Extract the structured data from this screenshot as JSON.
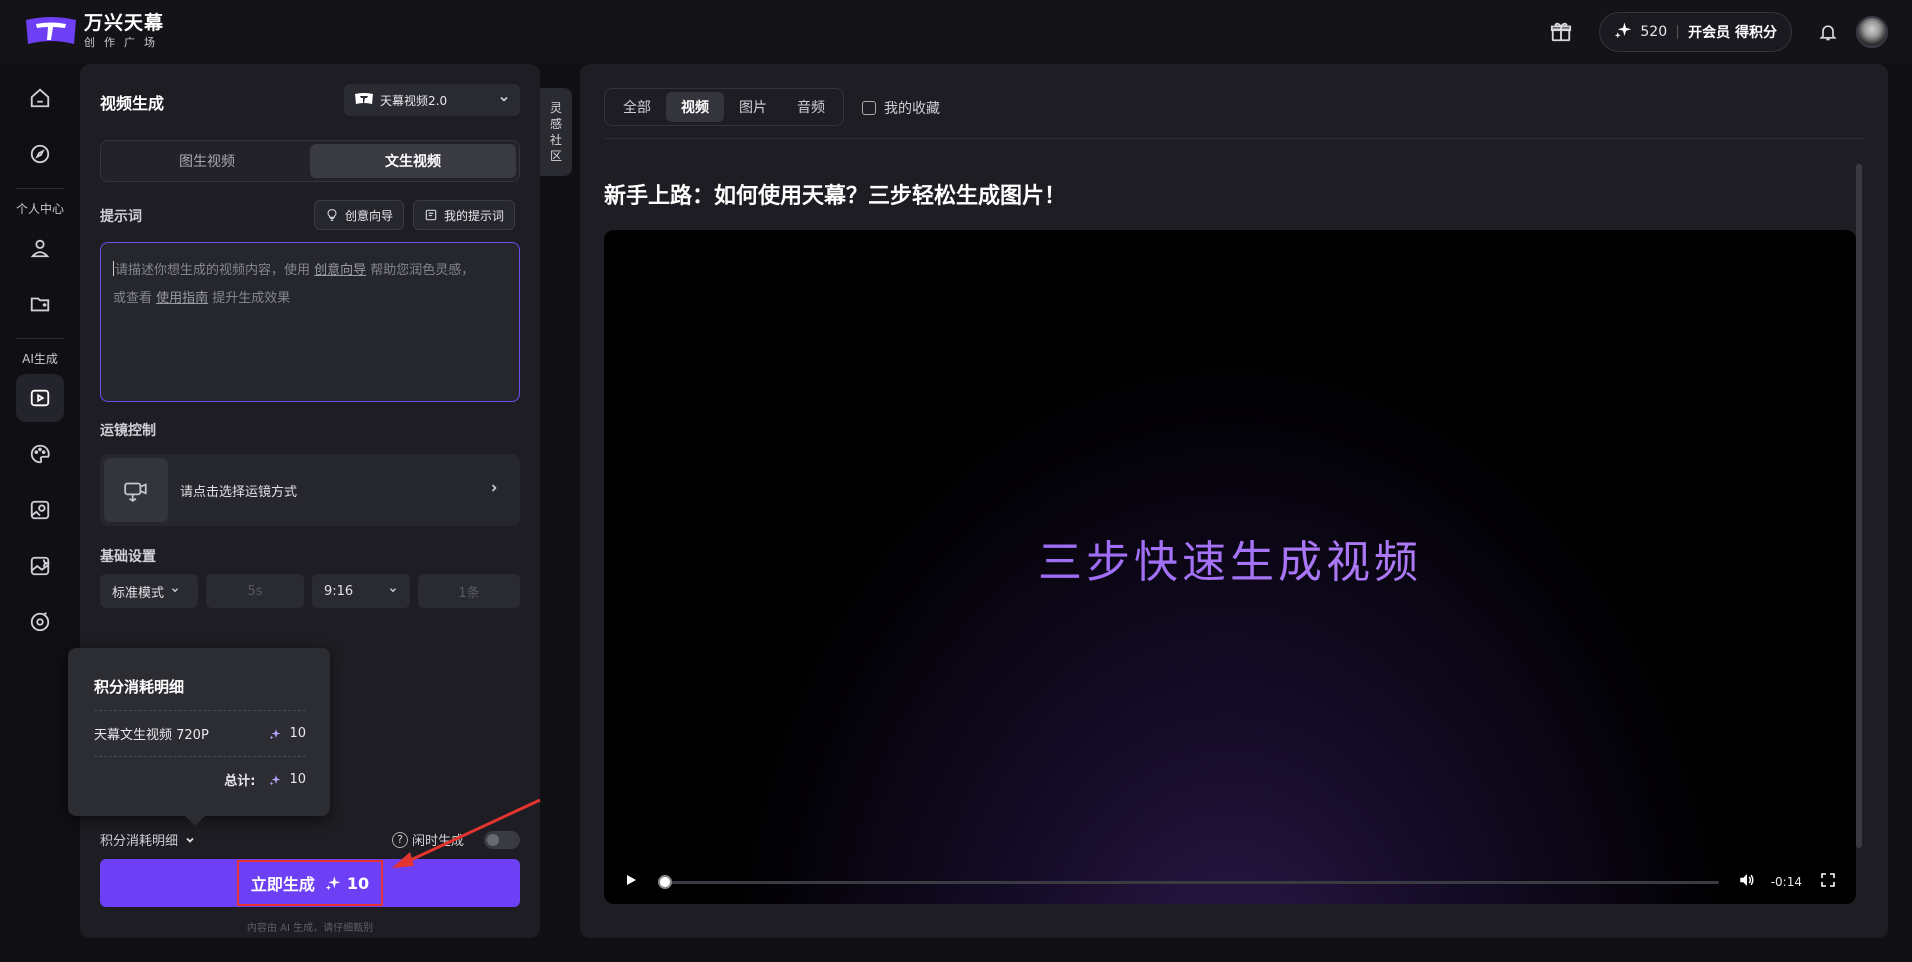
{
  "brand": {
    "title": "万兴天幕",
    "subtitle": "创作广场"
  },
  "header": {
    "points": "520",
    "vip_label": "开会员 得积分"
  },
  "rail": {
    "section_personal": "个人中心",
    "section_ai": "AI生成"
  },
  "panel": {
    "title": "视频生成",
    "model": "天幕视频2.0",
    "mode_tabs": [
      "图生视频",
      "文生视频"
    ],
    "active_mode": 1,
    "prompt_label": "提示词",
    "creative_guide_btn": "创意向导",
    "my_prompts_btn": "我的提示词",
    "prompt_placeholder": {
      "part1": "请描述你想生成的视频内容，使用 ",
      "link1": "创意向导",
      "part2": " 帮助您润色灵感，",
      "part3": "或查看 ",
      "link2": "使用指南",
      "part4": " 提升生成效果"
    },
    "camera_label": "运镜控制",
    "camera_placeholder": "请点击选择运镜方式",
    "basic_label": "基础设置",
    "settings": {
      "mode": "标准模式",
      "duration": "5s",
      "ratio": "9:16",
      "count": "1条"
    },
    "cost_tooltip": {
      "title": "积分消耗明细",
      "item_name": "天幕文生视频 720P",
      "item_cost": "10",
      "total_label": "总计:",
      "total_cost": "10"
    },
    "cost_toggle": "积分消耗明细",
    "idle_label": "闲时生成",
    "generate_label": "立即生成",
    "generate_cost": "10",
    "disclaimer": "内容由 AI 生成，请仔细甄别"
  },
  "inspire_tab": [
    "灵",
    "感",
    "社",
    "区"
  ],
  "main": {
    "tabs": [
      "全部",
      "视频",
      "图片",
      "音频"
    ],
    "active_tab": 1,
    "favorites_label": "我的收藏",
    "article_title": "新手上路：如何使用天幕？三步轻松生成图片！",
    "video_caption": "三步快速生成视频",
    "video_time": "-0:14",
    "video_progress": 0
  },
  "colors": {
    "accent": "#6d3ff5",
    "annotation": "#e3342f"
  }
}
